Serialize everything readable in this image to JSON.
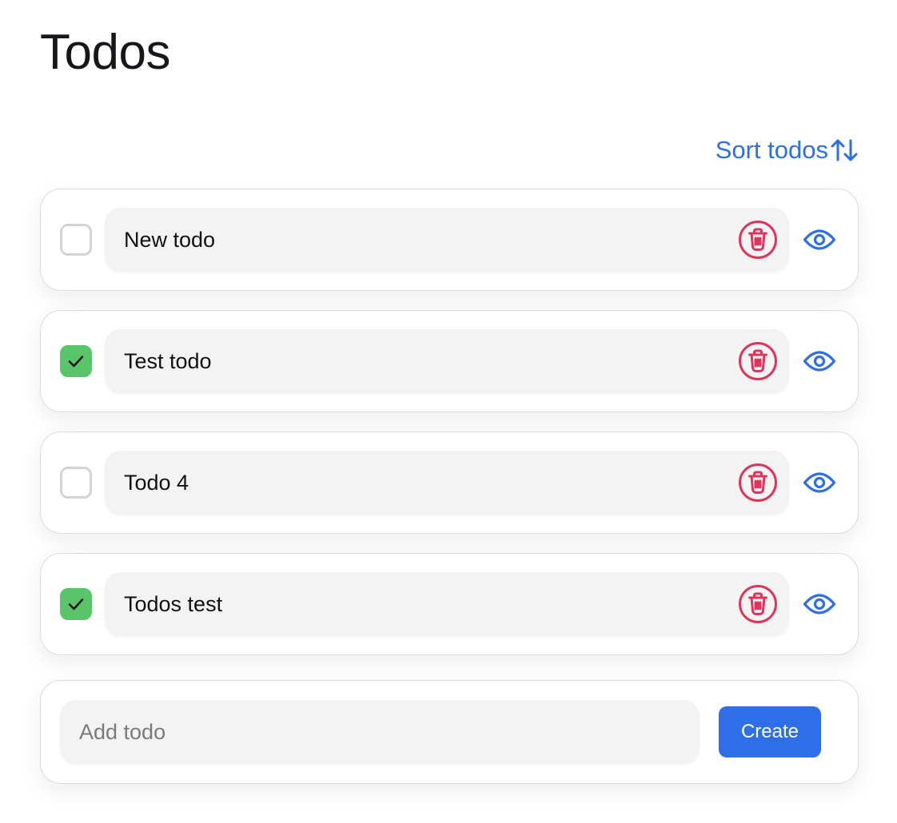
{
  "header": {
    "title": "Todos"
  },
  "toolbar": {
    "sort_label": "Sort todos",
    "sort_icon": "arrows-up-down-icon"
  },
  "todos": [
    {
      "text": "New todo",
      "completed": false
    },
    {
      "text": "Test todo",
      "completed": true
    },
    {
      "text": "Todo 4",
      "completed": false
    },
    {
      "text": "Todos test",
      "completed": true
    }
  ],
  "todo_actions": {
    "delete_icon": "trash-icon",
    "view_icon": "eye-icon"
  },
  "create": {
    "placeholder": "Add todo",
    "value": "",
    "button_label": "Create"
  },
  "colors": {
    "accent": "#2e6ee6",
    "check_green": "#5ac46b",
    "delete_red": "#e0345e"
  }
}
